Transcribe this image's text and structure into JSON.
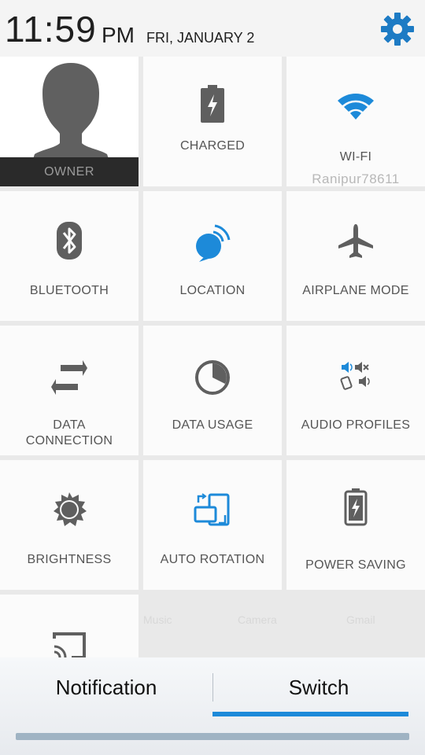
{
  "status_bar": {
    "time": "11:59",
    "ampm": "PM",
    "date": "FRI, JANUARY 2"
  },
  "tiles": {
    "owner": "OWNER",
    "charged": "CHARGED",
    "wifi": "WI-FI",
    "wifi_network": "Ranipur78611",
    "bluetooth": "BLUETOOTH",
    "location": "LOCATION",
    "airplane": "AIRPLANE MODE",
    "data_connection_line1": "DATA",
    "data_connection_line2": "CONNECTION",
    "data_usage": "DATA USAGE",
    "audio_profiles": "AUDIO PROFILES",
    "brightness": "BRIGHTNESS",
    "auto_rotation": "AUTO ROTATION",
    "power_saving": "POWER SAVING"
  },
  "background_labels": [
    "Music",
    "Camera",
    "Gmail"
  ],
  "tabs": {
    "notification": "Notification",
    "switch": "Switch"
  },
  "colors": {
    "accent_blue": "#1d8ad9",
    "icon_gray": "#666666"
  }
}
